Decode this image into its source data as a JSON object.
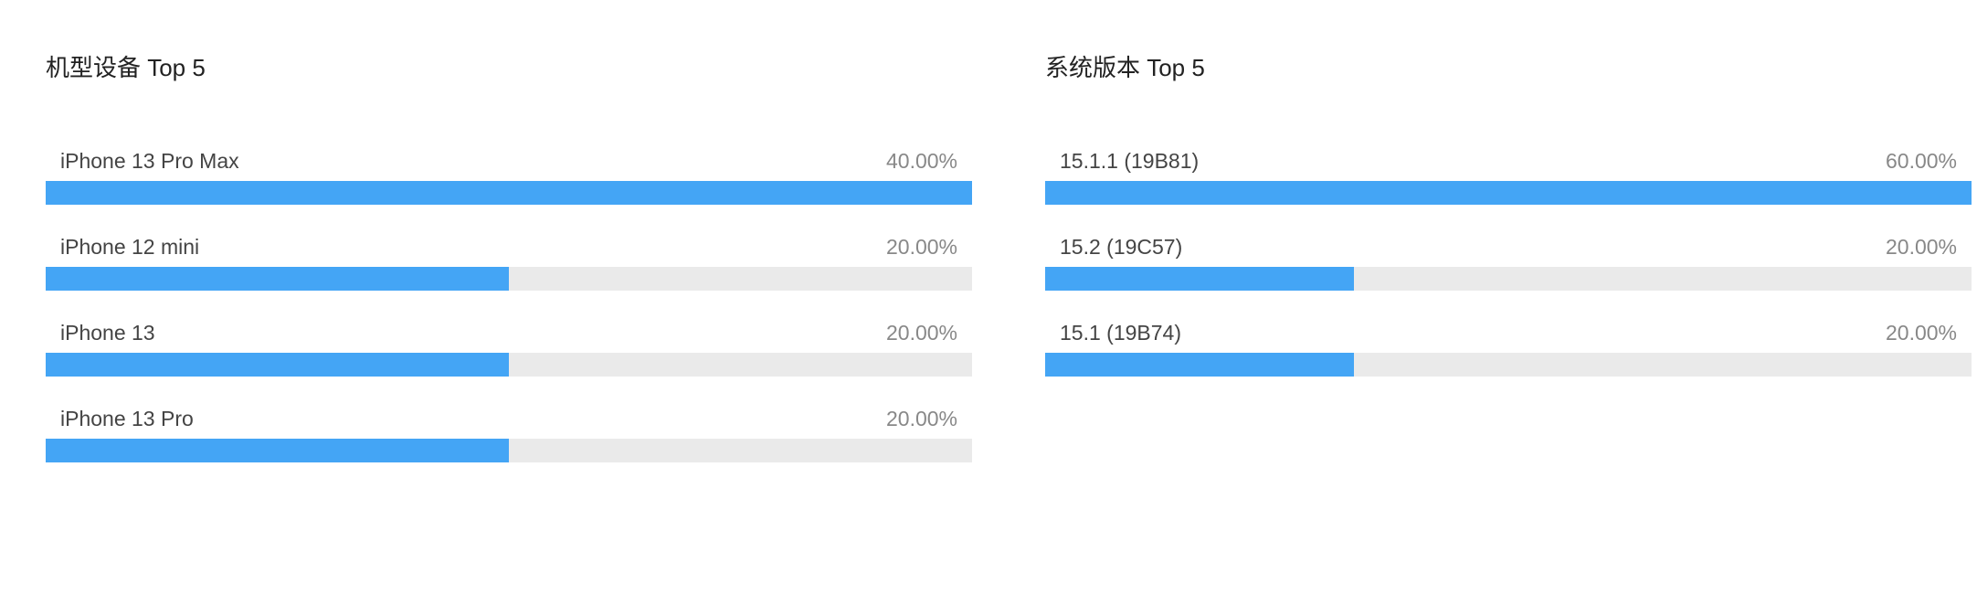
{
  "colors": {
    "bar_fill": "#44a5f5",
    "bar_track": "#eaeaea"
  },
  "panels": [
    {
      "title": "机型设备 Top 5"
    },
    {
      "title": "系统版本 Top 5"
    }
  ],
  "chart_data": [
    {
      "type": "bar",
      "orientation": "horizontal",
      "title": "机型设备 Top 5",
      "categories": [
        "iPhone 13 Pro Max",
        "iPhone 12 mini",
        "iPhone 13",
        "iPhone 13 Pro"
      ],
      "values": [
        40,
        20,
        20,
        20
      ],
      "value_labels": [
        "40.00%",
        "20.00%",
        "20.00%",
        "20.00%"
      ],
      "xlim": [
        0,
        40
      ],
      "grid": false,
      "legend": "none"
    },
    {
      "type": "bar",
      "orientation": "horizontal",
      "title": "系统版本 Top 5",
      "categories": [
        "15.1.1 (19B81)",
        "15.2 (19C57)",
        "15.1 (19B74)"
      ],
      "values": [
        60,
        20,
        20
      ],
      "value_labels": [
        "60.00%",
        "20.00%",
        "20.00%"
      ],
      "xlim": [
        0,
        60
      ],
      "grid": false,
      "legend": "none"
    }
  ]
}
